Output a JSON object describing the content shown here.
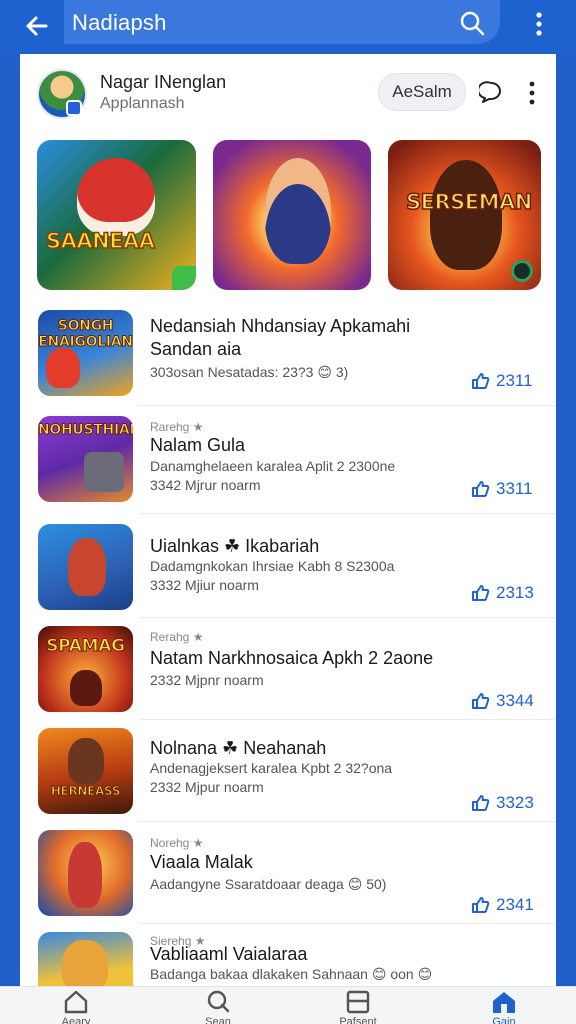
{
  "appbar": {
    "title": "Nadiapsh"
  },
  "profile": {
    "name": "Nagar INenglan",
    "subtitle": "Applannash",
    "action_label": "AeSalm"
  },
  "featured": [
    {
      "logo": "SAANEAA",
      "corner": "ft"
    },
    {
      "logo": ""
    },
    {
      "logo": "SERSEMAN"
    }
  ],
  "items": [
    {
      "thumb_text": "SONGH ENAIGOLIAN",
      "tag": "",
      "title_lines": [
        "Nedansiah Nhdansiay Apkamahi",
        "Sandan aia"
      ],
      "lines": [
        "303osan Nesatadas: 23?3 😊 3)"
      ],
      "count": "2311"
    },
    {
      "thumb_text": "NOHUSTHIAN",
      "tag": "Rarehg ★",
      "title_lines": [
        "Nalam Gula"
      ],
      "lines": [
        "Danamghelaeen karalea Aplit 2 2300ne",
        "3342 Mjrur noarm"
      ],
      "count": "3311"
    },
    {
      "thumb_text": "",
      "tag": "",
      "title_lines": [
        "Uialnkas ☘ Ikabariah"
      ],
      "lines": [
        "Dadamgnkokan Ihrsiae Kabh 8 S2300a",
        "3332 Mjiur noarm"
      ],
      "count": "2313"
    },
    {
      "thumb_text": "SPAMAG",
      "tag": "Rerahg ★",
      "title_lines": [
        "Natam Narkhnosaica Apkh 2 2aone"
      ],
      "lines": [
        "2332 Mjpnr noarm"
      ],
      "count": "3344"
    },
    {
      "thumb_text": "HERNEASS",
      "tag": "",
      "title_lines": [
        "Nolnana ☘ Neahanah"
      ],
      "lines": [
        "Andenagjeksert karalea Kpbt 2 32?ona",
        "2332 Mjpur noarm"
      ],
      "count": "3323"
    },
    {
      "thumb_text": "",
      "tag": "Norehg ★",
      "title_lines": [
        "Viaala Malak"
      ],
      "lines": [
        "Aadangyne Ssaratdoaar deaga 😊 50)"
      ],
      "count": "2341"
    },
    {
      "thumb_text": "",
      "tag": "Sierehg ★",
      "title_lines": [
        "Vabliaaml Vaialaraa"
      ],
      "lines": [
        "Badanga bakaa dlakaken Sahnaan 😊 oon 😊"
      ],
      "count": ""
    }
  ],
  "bottom_nav": [
    {
      "label": "Aeary",
      "icon": "home-outline-icon"
    },
    {
      "label": "Sean",
      "icon": "chat-search-icon"
    },
    {
      "label": "Pafsent",
      "icon": "list-box-icon"
    },
    {
      "label": "Gain",
      "icon": "home-filled-icon"
    }
  ],
  "colors": {
    "primary": "#1e62d0",
    "count": "#2463cf"
  }
}
